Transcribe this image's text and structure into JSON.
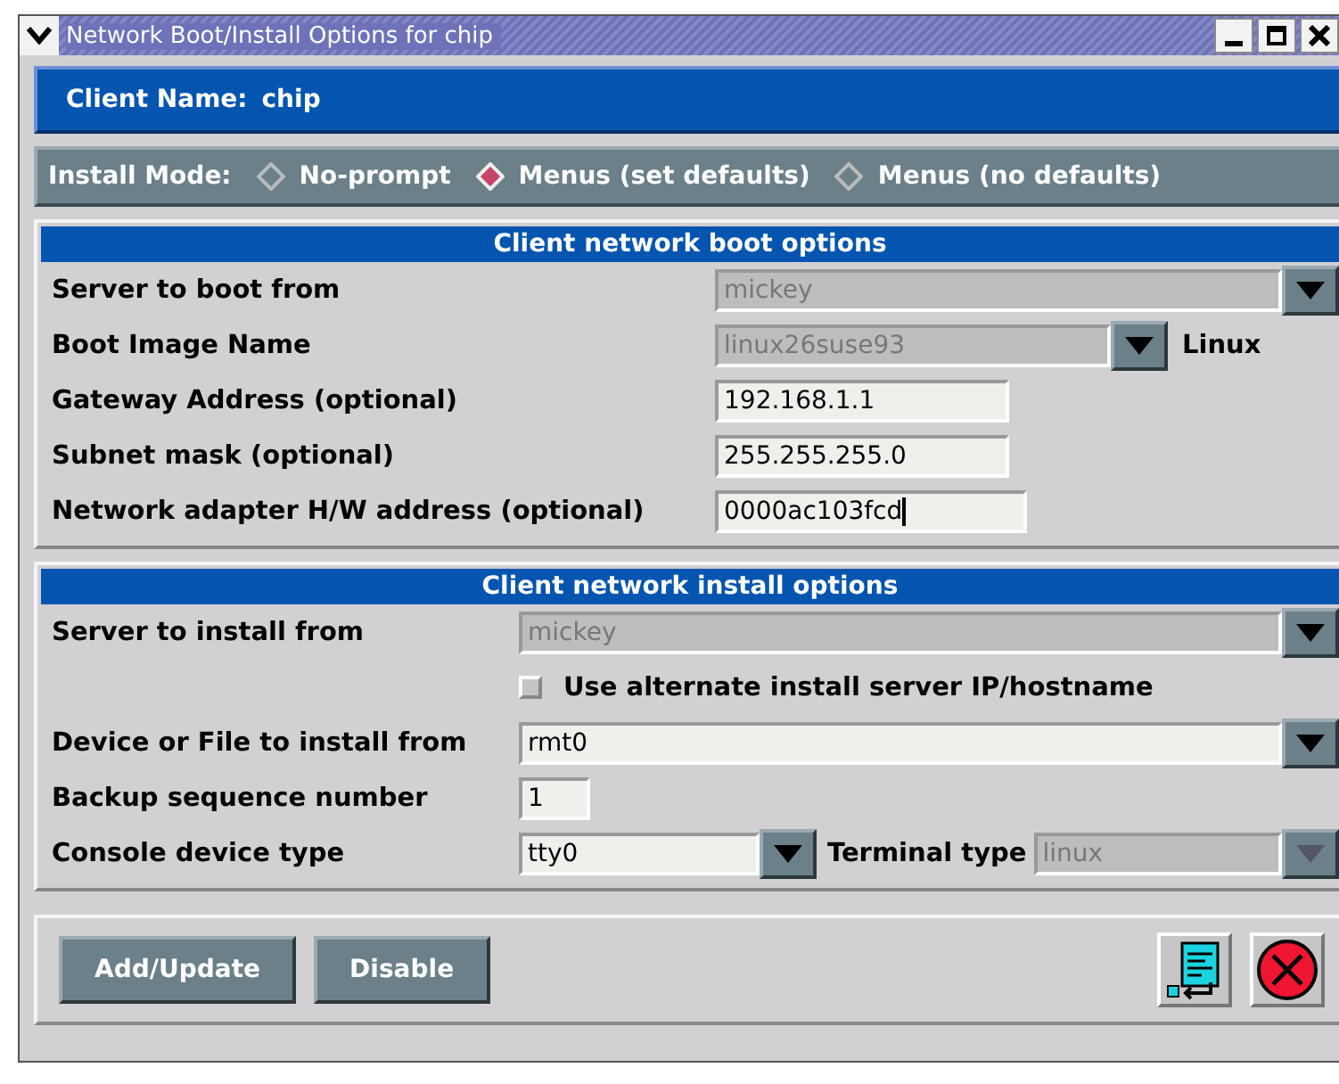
{
  "window": {
    "title": "Network Boot/Install Options for chip"
  },
  "client_name": {
    "label": "Client Name:",
    "value": "chip"
  },
  "install_mode": {
    "label": "Install Mode:",
    "options": [
      {
        "label": "No-prompt",
        "selected": false
      },
      {
        "label": "Menus (set defaults)",
        "selected": true
      },
      {
        "label": "Menus (no defaults)",
        "selected": false
      }
    ]
  },
  "boot_section": {
    "title": "Client network boot options",
    "rows": [
      {
        "kind": "combo",
        "label": "Server to boot from",
        "value": "mickey",
        "disabled": true
      },
      {
        "kind": "combo",
        "label": "Boot Image Name",
        "value": "linux26suse93",
        "disabled": true,
        "suffix": "Linux"
      },
      {
        "kind": "text",
        "label": "Gateway Address (optional)",
        "value": "192.168.1.1"
      },
      {
        "kind": "text",
        "label": "Subnet mask (optional)",
        "value": "255.255.255.0"
      },
      {
        "kind": "text",
        "label": "Network adapter H/W address (optional)",
        "value": "0000ac103fcd",
        "focused": true
      }
    ]
  },
  "install_section": {
    "title": "Client network install options",
    "rows": [
      {
        "kind": "combo",
        "label": "Server to install from",
        "value": "mickey",
        "disabled": true
      },
      {
        "kind": "checkbox",
        "label": "Use alternate install server IP/hostname",
        "checked": false
      },
      {
        "kind": "combo",
        "label": "Device or File to install from",
        "value": "rmt0",
        "disabled": false
      },
      {
        "kind": "short",
        "label": "Backup sequence number",
        "value": "1"
      },
      {
        "kind": "pair",
        "label": "Console device type",
        "value": "tty0",
        "disabled": false,
        "second_label": "Terminal type",
        "second_value": "linux",
        "second_disabled": true
      }
    ]
  },
  "buttons": [
    "Add/Update",
    "Disable"
  ]
}
